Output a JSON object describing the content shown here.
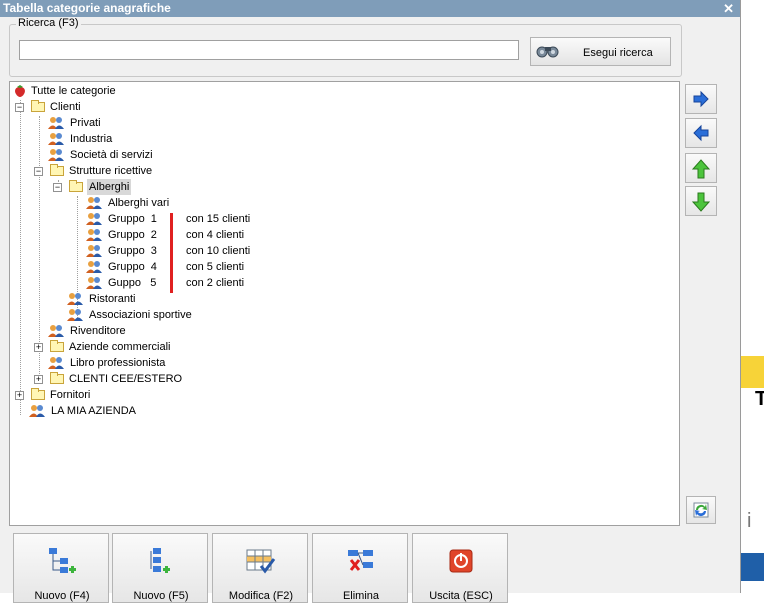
{
  "window": {
    "title": "Tabella categorie anagrafiche",
    "close_glyph": "✕"
  },
  "search": {
    "group_label": "Ricerca (F3)",
    "value": "",
    "button_label": "Esegui ricerca"
  },
  "tree": {
    "root": "Tutte le categorie",
    "clienti": "Clienti",
    "privati": "Privati",
    "industria": "Industria",
    "societa": "Società di servizi",
    "strutture": "Strutture ricettive",
    "alberghi": "Alberghi",
    "alberghi_vari": "Alberghi vari",
    "gruppo1": "Gruppo  1",
    "gruppo2": "Gruppo  2",
    "gruppo3": "Gruppo  3",
    "gruppo4": "Gruppo  4",
    "gruppo5": "Guppo   5",
    "ristoranti": "Ristoranti",
    "associazioni": "Associazioni sportive",
    "rivenditore": "Rivenditore",
    "aziende": "Aziende commerciali",
    "libro": "Libro professionista",
    "cee": "CLENTI CEE/ESTERO",
    "fornitori": "Fornitori",
    "azienda": "LA MIA AZIENDA",
    "expand_plus": "+",
    "expand_minus": "−"
  },
  "annotations": [
    "con 15 clienti",
    "con 4 clienti",
    "con 10 clienti",
    "con 5 clienti",
    "con 2 clienti"
  ],
  "bottom_buttons": [
    "Nuovo (F4)",
    "Nuovo (F5)",
    "Modifica (F2)",
    "Elimina",
    "Uscita (ESC)"
  ],
  "side_strip": {
    "letter_1": "T",
    "letter_2": "i"
  },
  "colors": {
    "titlebar": "#7f9db9",
    "annotation_bar": "#e02020",
    "side_yellow": "#f7d338",
    "side_blue": "#1f5fa8"
  },
  "icons": {
    "root": "strawberry-icon",
    "folder": "folder-icon",
    "users": "users-icon",
    "search": "binoculars-icon",
    "arrow_right": "arrow-right-icon",
    "arrow_left": "arrow-left-icon",
    "arrow_up": "arrow-up-icon",
    "arrow_down": "arrow-down-icon",
    "refresh": "refresh-icon"
  }
}
